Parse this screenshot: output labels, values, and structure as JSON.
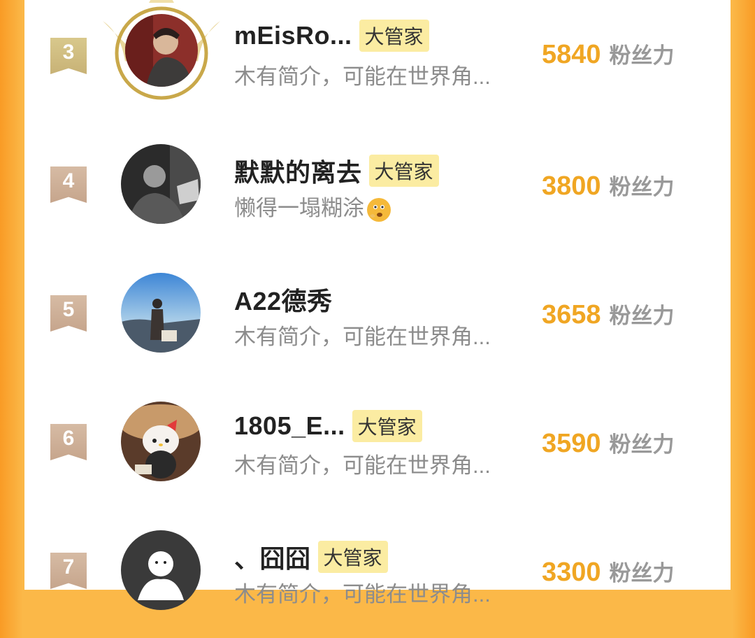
{
  "rows": [
    {
      "rank": "3",
      "name": "mEisRo...",
      "badge": "大管家",
      "bio": "木有简介，可能在世界角...",
      "score": "5840",
      "unit": "粉丝力"
    },
    {
      "rank": "4",
      "name": "默默的离去",
      "badge": "大管家",
      "bio": "懒得一塌糊涂",
      "bio_emoji": "thinking-face-emoji",
      "score": "3800",
      "unit": "粉丝力"
    },
    {
      "rank": "5",
      "name": "A22德秀",
      "badge": "",
      "bio": "木有简介，可能在世界角...",
      "score": "3658",
      "unit": "粉丝力"
    },
    {
      "rank": "6",
      "name": "1805_E...",
      "badge": "大管家",
      "bio": "木有简介，可能在世界角...",
      "score": "3590",
      "unit": "粉丝力"
    },
    {
      "rank": "7",
      "name": "、囧囧",
      "badge": "大管家",
      "bio": "木有简介，可能在世界角...",
      "score": "3300",
      "unit": "粉丝力"
    }
  ],
  "colors": {
    "accent": "#f0a623",
    "badge_bg": "#fbeca2",
    "side_bg": "#fbb848"
  }
}
